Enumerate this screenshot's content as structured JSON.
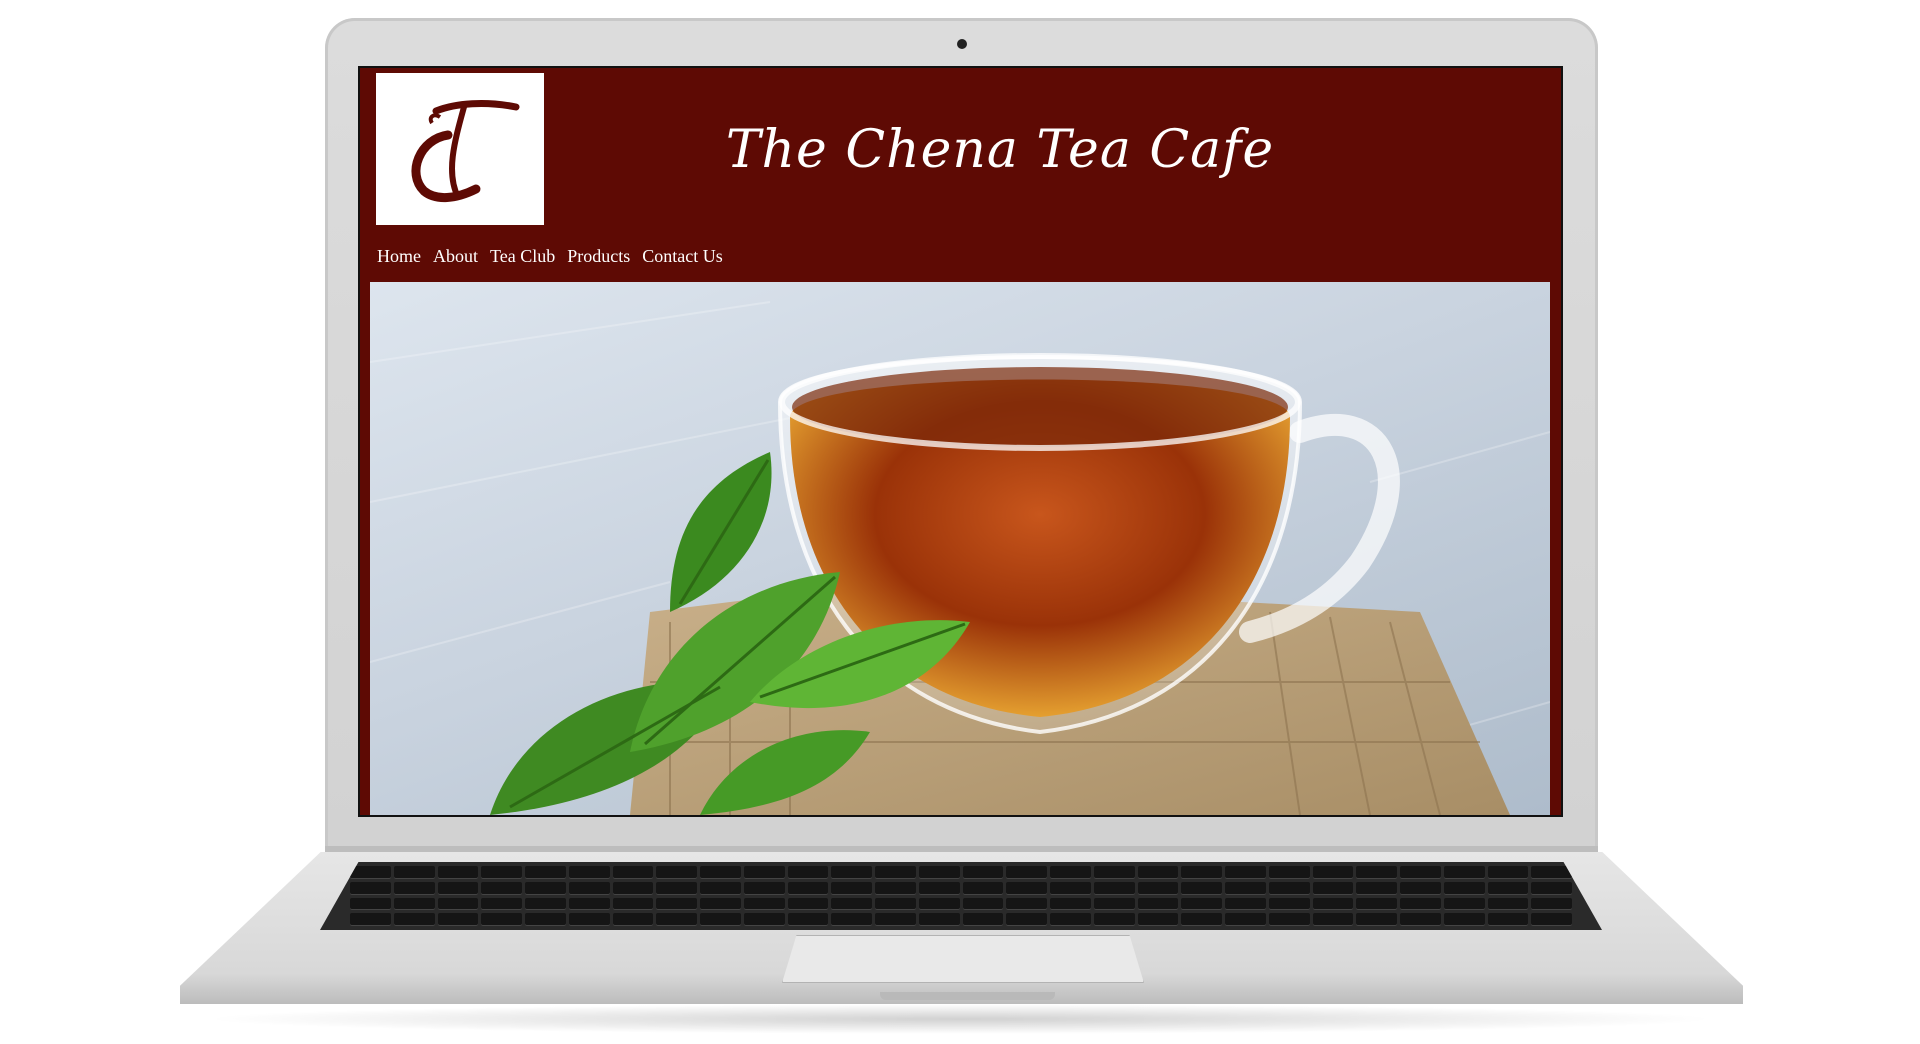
{
  "site": {
    "title": "The Chena Tea Cafe",
    "logo_text": "TC",
    "nav": [
      "Home",
      "About",
      "Tea Club",
      "Products",
      "Contact Us"
    ]
  },
  "colors": {
    "brand_maroon": "#5e0a04",
    "header_text": "#ffffff",
    "logo_background": "#ffffff",
    "laptop_silver": "#d8d8d8",
    "keyboard": "#2a2a2a"
  },
  "hero": {
    "image": "tea-cup-with-nettle-leaves-photo"
  }
}
